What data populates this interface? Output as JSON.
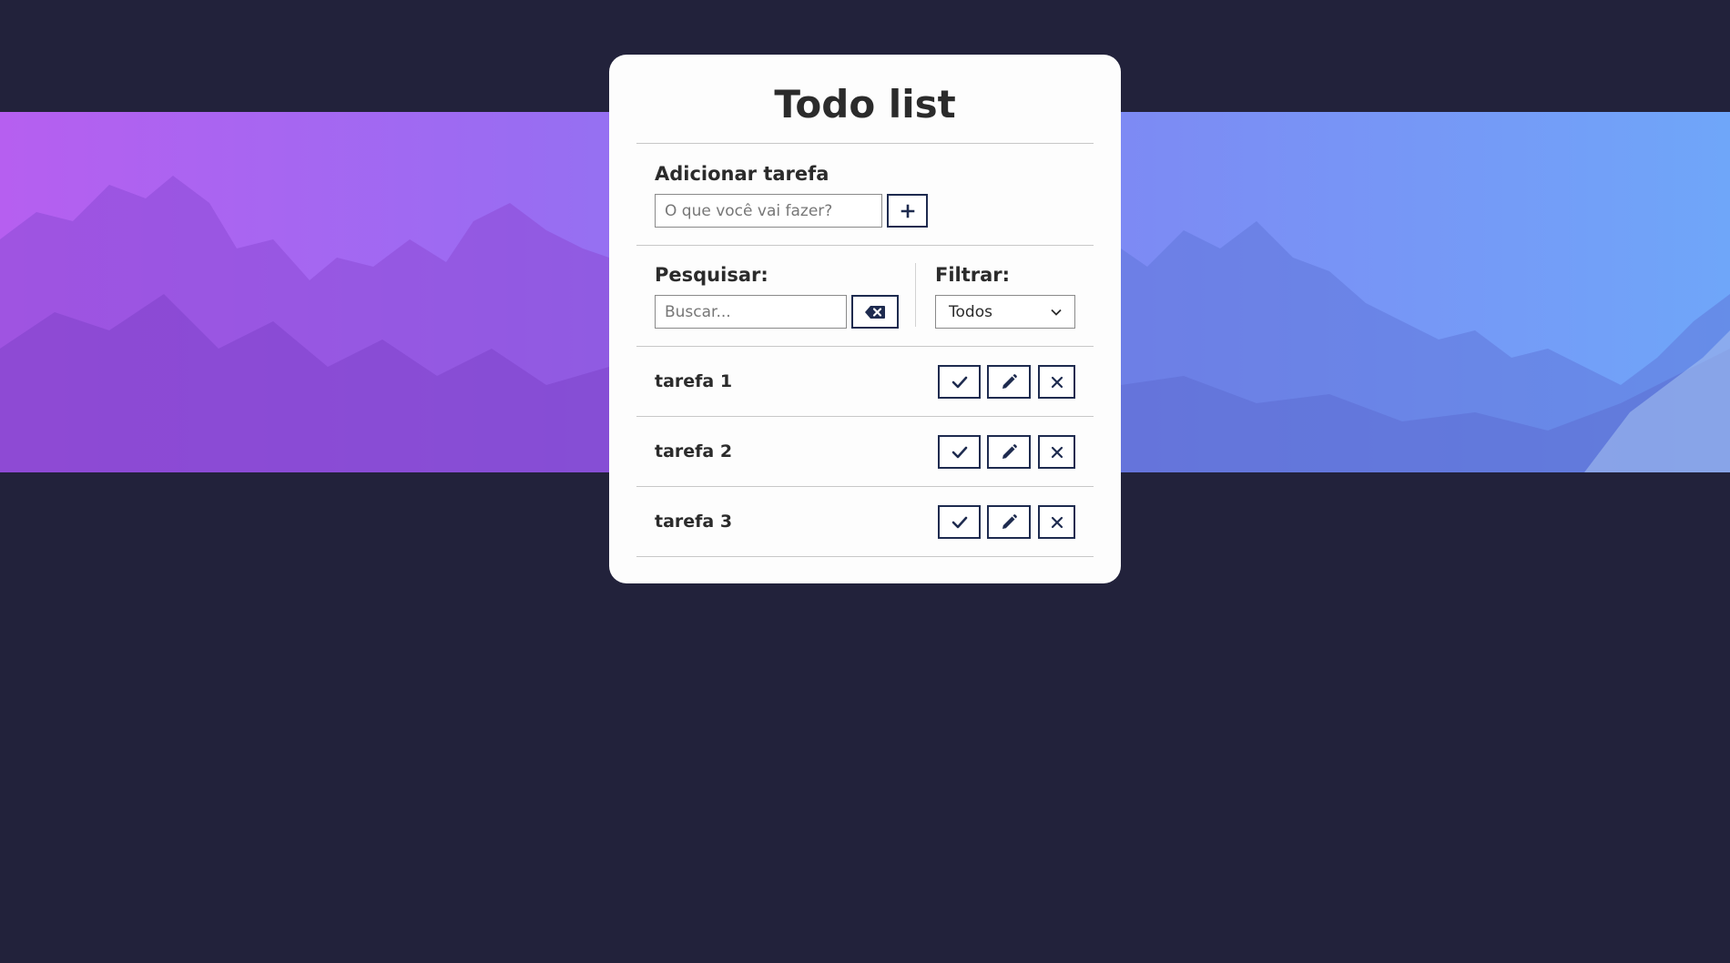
{
  "app": {
    "title": "Todo list"
  },
  "add_task": {
    "label": "Adicionar tarefa",
    "input_placeholder": "O que você vai fazer?",
    "input_value": "",
    "add_button_icon": "plus-icon"
  },
  "search": {
    "label": "Pesquisar:",
    "input_placeholder": "Buscar...",
    "input_value": "",
    "clear_button_icon": "backspace-icon"
  },
  "filter": {
    "label": "Filtrar:",
    "selected": "Todos"
  },
  "todos": [
    {
      "text": "tarefa 1"
    },
    {
      "text": "tarefa 2"
    },
    {
      "text": "tarefa 3"
    }
  ],
  "todo_actions": {
    "done_icon": "check-icon",
    "edit_icon": "pencil-icon",
    "remove_icon": "close-icon"
  },
  "colors": {
    "background": "#22223b",
    "card": "#fdfdfd",
    "accent": "#1e2b4f",
    "banner_left": "#b65ff0",
    "banner_right": "#6fa6f9"
  }
}
